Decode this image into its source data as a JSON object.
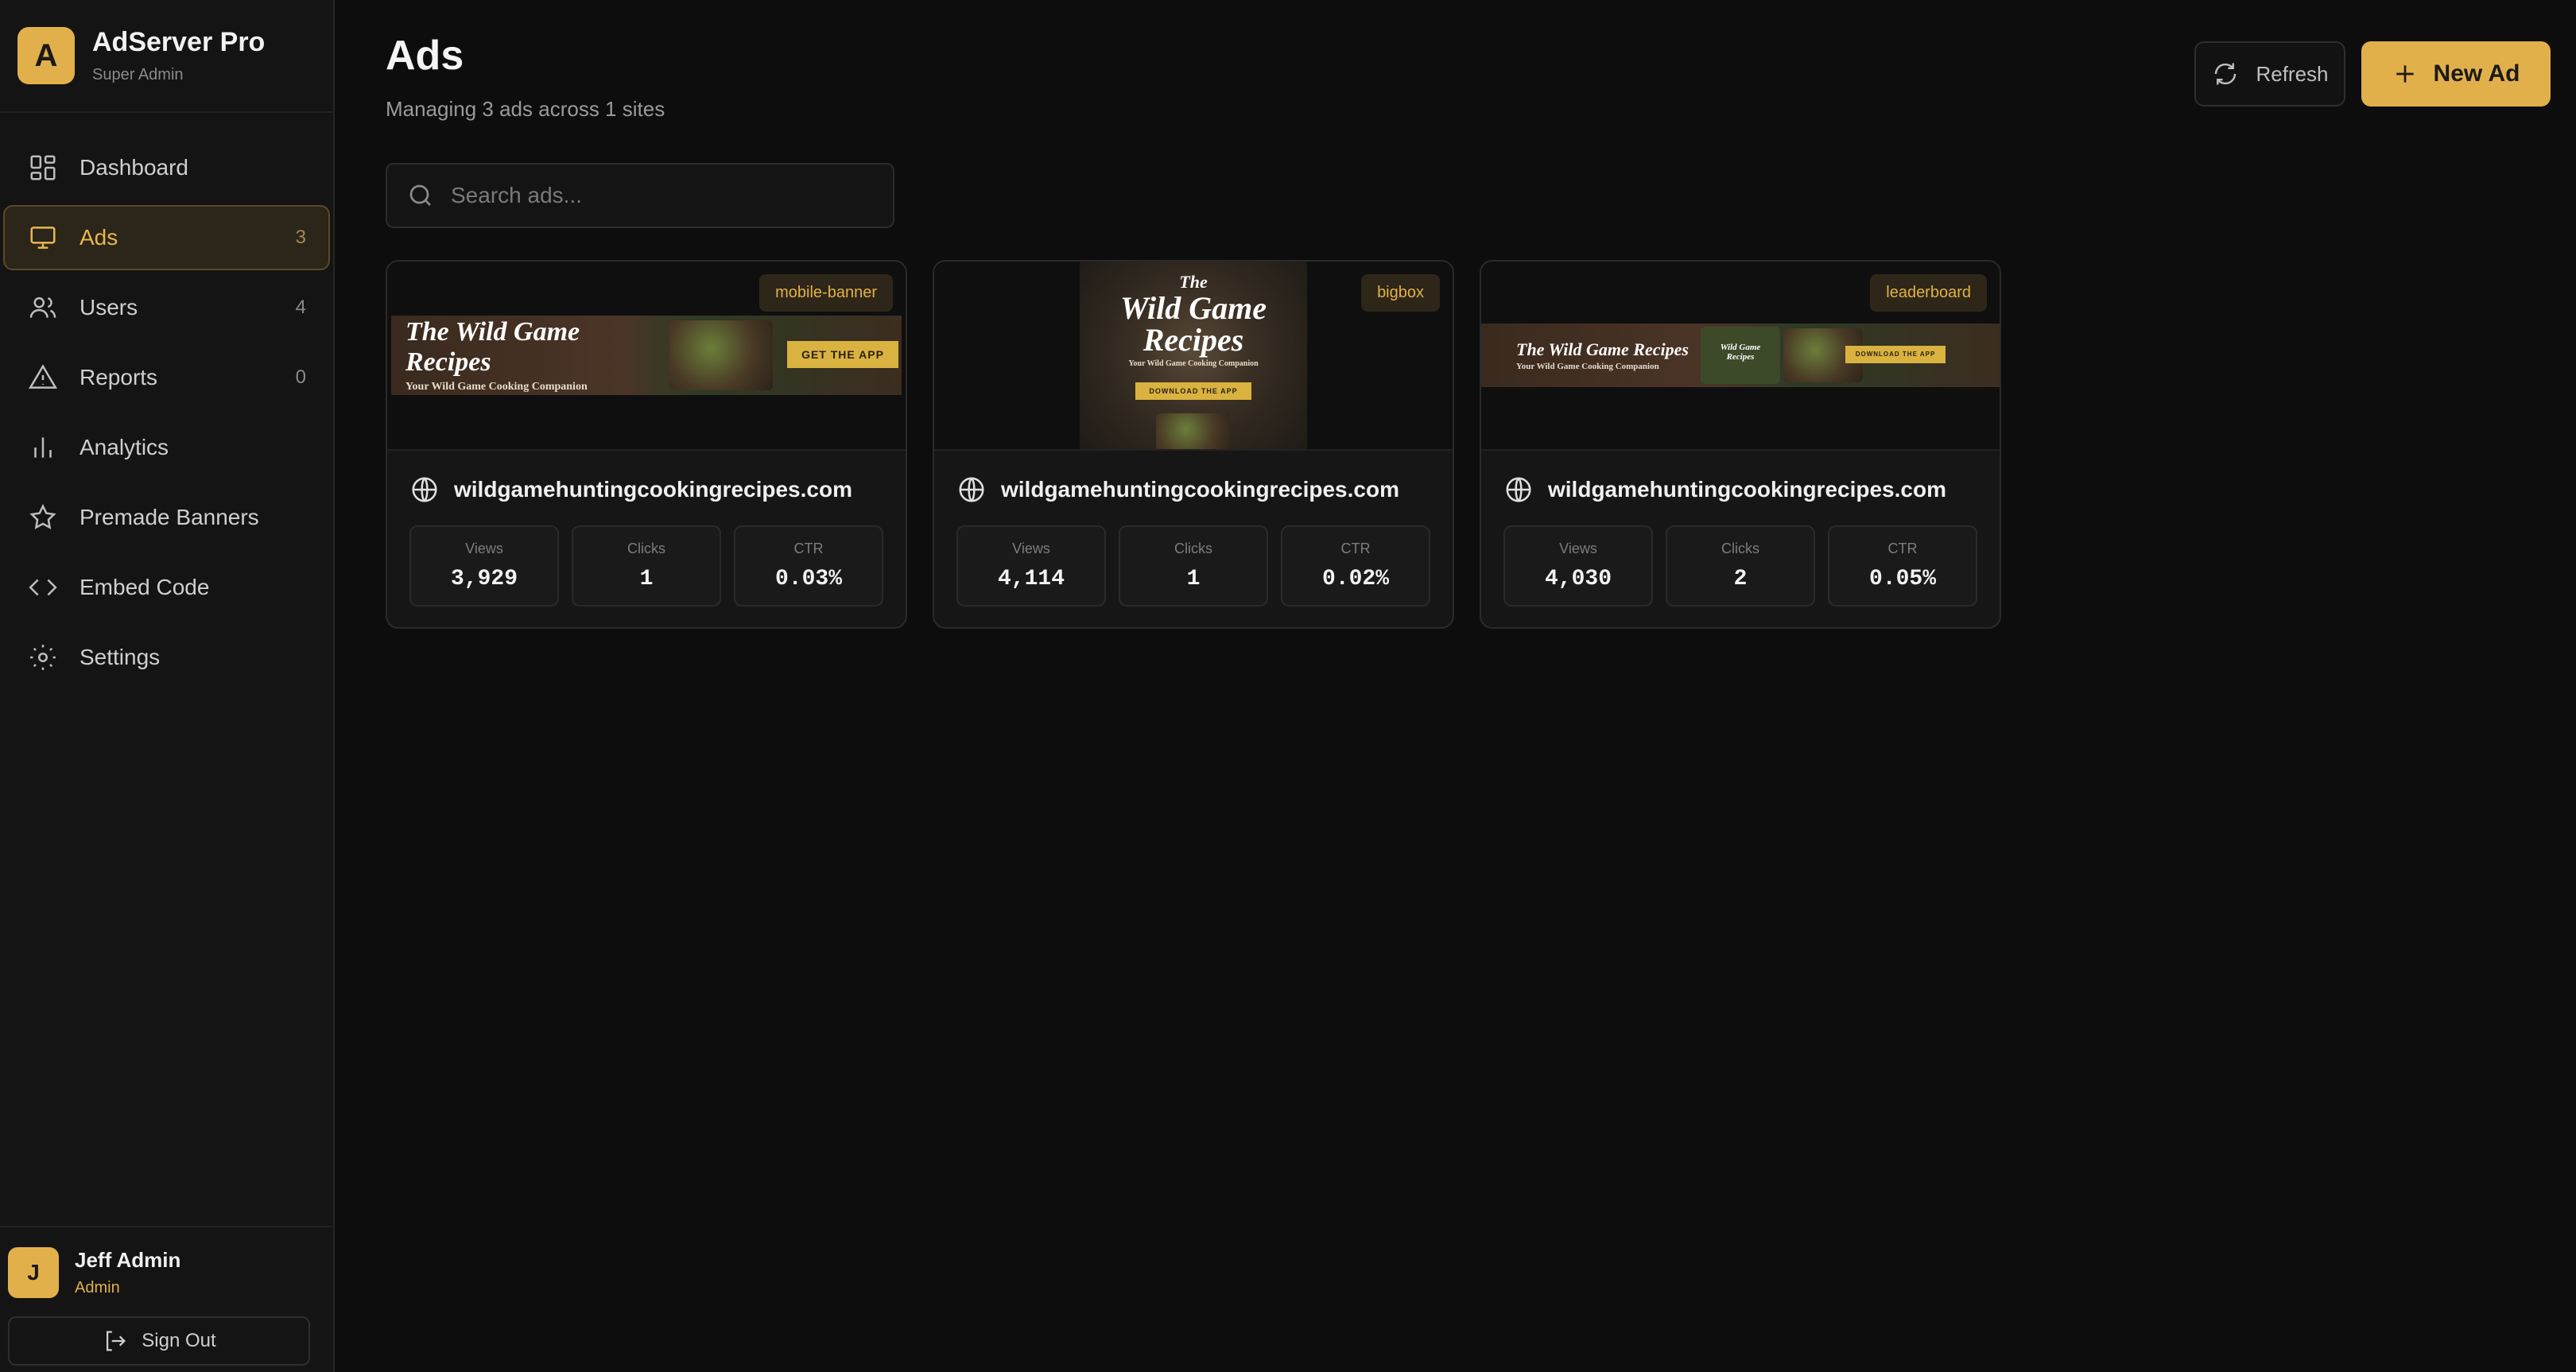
{
  "brand": {
    "logo_letter": "A",
    "name": "AdServer Pro",
    "role": "Super Admin"
  },
  "nav": [
    {
      "label": "Dashboard",
      "count": "",
      "icon": "dashboard-icon",
      "active": false
    },
    {
      "label": "Ads",
      "count": "3",
      "icon": "monitor-icon",
      "active": true
    },
    {
      "label": "Users",
      "count": "4",
      "icon": "users-icon",
      "active": false
    },
    {
      "label": "Reports",
      "count": "0",
      "icon": "warning-icon",
      "active": false
    },
    {
      "label": "Analytics",
      "count": "",
      "icon": "bar-chart-icon",
      "active": false
    },
    {
      "label": "Premade Banners",
      "count": "",
      "icon": "star-icon",
      "active": false
    },
    {
      "label": "Embed Code",
      "count": "",
      "icon": "code-icon",
      "active": false
    },
    {
      "label": "Settings",
      "count": "",
      "icon": "gear-icon",
      "active": false
    }
  ],
  "user": {
    "avatar_letter": "J",
    "name": "Jeff Admin",
    "role": "Admin",
    "signout_label": "Sign Out"
  },
  "page": {
    "title": "Ads",
    "subtitle": "Managing 3 ads across 1 sites"
  },
  "actions": {
    "refresh_label": "Refresh",
    "new_label": "New Ad"
  },
  "search": {
    "placeholder": "Search ads...",
    "value": ""
  },
  "banner_text": {
    "title_line": "The Wild Game Recipes",
    "tagline": "Your Wild Game Cooking Companion",
    "cta_get": "GET THE APP",
    "cta_download": "DOWNLOAD THE APP",
    "big_the": "The",
    "big_wild": "Wild Game",
    "big_recipes": "Recipes",
    "phone_line1": "Wild Game",
    "phone_line2": "Recipes"
  },
  "stat_labels": {
    "views": "Views",
    "clicks": "Clicks",
    "ctr": "CTR"
  },
  "ads": [
    {
      "size": "mobile-banner",
      "site": "wildgamehuntingcookingrecipes.com",
      "views": "3,929",
      "clicks": "1",
      "ctr": "0.03%"
    },
    {
      "size": "bigbox",
      "site": "wildgamehuntingcookingrecipes.com",
      "views": "4,114",
      "clicks": "1",
      "ctr": "0.02%"
    },
    {
      "size": "leaderboard",
      "site": "wildgamehuntingcookingrecipes.com",
      "views": "4,030",
      "clicks": "2",
      "ctr": "0.05%"
    }
  ],
  "colors": {
    "accent": "#e2b04a",
    "background": "#0d0d0d",
    "sidebar": "#141414",
    "card": "#161616"
  }
}
